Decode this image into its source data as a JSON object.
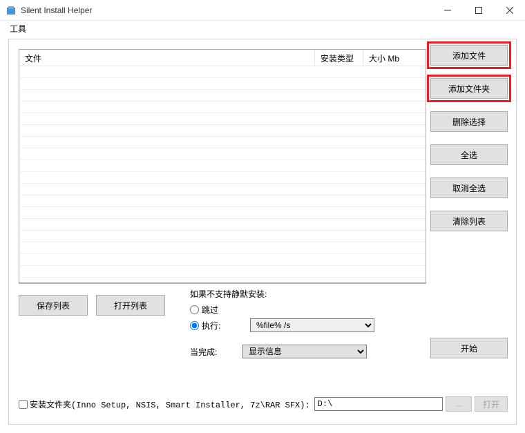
{
  "window": {
    "title": "Silent Install Helper"
  },
  "menubar": {
    "tools": "工具"
  },
  "table": {
    "col_file": "文件",
    "col_type": "安装类型",
    "col_size": "大小 Mb"
  },
  "buttons": {
    "add_file": "添加文件",
    "add_folder": "添加文件夹",
    "delete_selected": "删除选择",
    "select_all": "全选",
    "deselect_all": "取消全选",
    "clear_list": "清除列表",
    "save_list": "保存列表",
    "open_list": "打开列表",
    "start": "开始",
    "browse": "...",
    "open": "打开"
  },
  "options": {
    "unsupported_label": "如果不支持静默安装:",
    "skip": "跳过",
    "execute": "执行:",
    "execute_value": "%file% /s",
    "complete_label": "当完成:",
    "complete_value": "显示信息"
  },
  "install_folder": {
    "checkbox_label": "安装文件夹(Inno Setup, NSIS, Smart Installer, 7z\\RAR SFX):",
    "path": "D:\\"
  }
}
